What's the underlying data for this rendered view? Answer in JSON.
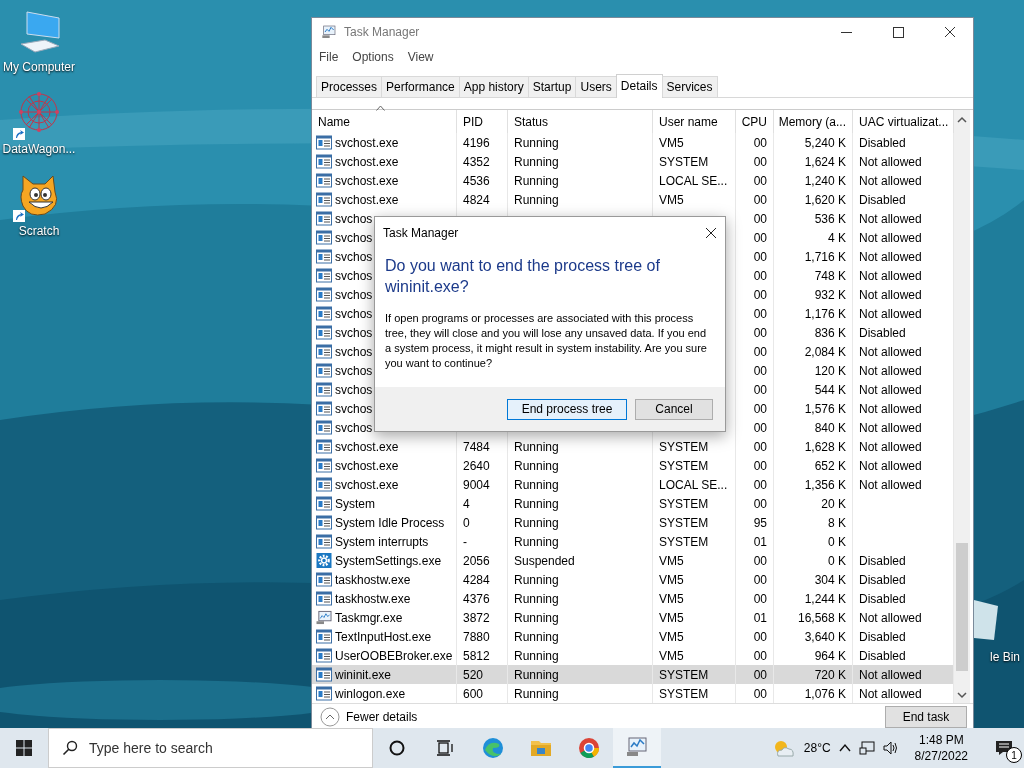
{
  "desktop_icons": [
    {
      "label": "My Computer",
      "kind": "computer",
      "shortcut": false
    },
    {
      "label": "DataWagon...",
      "kind": "network",
      "shortcut": true
    },
    {
      "label": "Scratch",
      "kind": "cat",
      "shortcut": true
    }
  ],
  "recycle_bin": {
    "label": "le Bin"
  },
  "window": {
    "title": "Task Manager",
    "menu": [
      "File",
      "Options",
      "View"
    ],
    "tabs": [
      {
        "label": "Processes",
        "selected": false
      },
      {
        "label": "Performance",
        "selected": false
      },
      {
        "label": "App history",
        "selected": false
      },
      {
        "label": "Startup",
        "selected": false
      },
      {
        "label": "Users",
        "selected": false
      },
      {
        "label": "Details",
        "selected": true
      },
      {
        "label": "Services",
        "selected": false
      }
    ],
    "table": {
      "columns": [
        {
          "label": "Name",
          "sorted": true
        },
        {
          "label": "PID",
          "sorted": false
        },
        {
          "label": "Status",
          "sorted": false
        },
        {
          "label": "User name",
          "sorted": false
        },
        {
          "label": "CPU",
          "sorted": false
        },
        {
          "label": "Memory (a...",
          "sorted": false
        },
        {
          "label": "UAC virtualizat...",
          "sorted": false
        }
      ],
      "rows": [
        {
          "kind": "app",
          "cells": [
            "svchost.exe",
            "4196",
            "Running",
            "VM5",
            "00",
            "5,240 K",
            "Disabled"
          ],
          "selected": false
        },
        {
          "kind": "app",
          "cells": [
            "svchost.exe",
            "4352",
            "Running",
            "SYSTEM",
            "00",
            "1,624 K",
            "Not allowed"
          ],
          "selected": false
        },
        {
          "kind": "app",
          "cells": [
            "svchost.exe",
            "4536",
            "Running",
            "LOCAL SE...",
            "00",
            "1,240 K",
            "Not allowed"
          ],
          "selected": false
        },
        {
          "kind": "app",
          "cells": [
            "svchost.exe",
            "4824",
            "Running",
            "VM5",
            "00",
            "1,620 K",
            "Disabled"
          ],
          "selected": false
        },
        {
          "kind": "app",
          "cells": [
            "svchos",
            null,
            null,
            null,
            "00",
            "536 K",
            "Not allowed"
          ],
          "selected": false
        },
        {
          "kind": "app",
          "cells": [
            "svchos",
            null,
            null,
            null,
            "00",
            "4 K",
            "Not allowed"
          ],
          "selected": false
        },
        {
          "kind": "app",
          "cells": [
            "svchos",
            null,
            null,
            null,
            "00",
            "1,716 K",
            "Not allowed"
          ],
          "selected": false
        },
        {
          "kind": "app",
          "cells": [
            "svchos",
            null,
            null,
            null,
            "00",
            "748 K",
            "Not allowed"
          ],
          "selected": false
        },
        {
          "kind": "app",
          "cells": [
            "svchos",
            null,
            null,
            null,
            "00",
            "932 K",
            "Not allowed"
          ],
          "selected": false
        },
        {
          "kind": "app",
          "cells": [
            "svchos",
            null,
            null,
            null,
            "00",
            "1,176 K",
            "Not allowed"
          ],
          "selected": false
        },
        {
          "kind": "app",
          "cells": [
            "svchos",
            null,
            null,
            null,
            "00",
            "836 K",
            "Disabled"
          ],
          "selected": false
        },
        {
          "kind": "app",
          "cells": [
            "svchos",
            null,
            null,
            null,
            "00",
            "2,084 K",
            "Not allowed"
          ],
          "selected": false
        },
        {
          "kind": "app",
          "cells": [
            "svchos",
            null,
            null,
            null,
            "00",
            "120 K",
            "Not allowed"
          ],
          "selected": false
        },
        {
          "kind": "app",
          "cells": [
            "svchos",
            null,
            null,
            null,
            "00",
            "544 K",
            "Not allowed"
          ],
          "selected": false
        },
        {
          "kind": "app",
          "cells": [
            "svchos",
            null,
            null,
            null,
            "00",
            "1,576 K",
            "Not allowed"
          ],
          "selected": false
        },
        {
          "kind": "app",
          "cells": [
            "svchos",
            null,
            null,
            null,
            "00",
            "840 K",
            "Not allowed"
          ],
          "selected": false
        },
        {
          "kind": "app",
          "cells": [
            "svchost.exe",
            "7484",
            "Running",
            "SYSTEM",
            "00",
            "1,628 K",
            "Not allowed"
          ],
          "selected": false
        },
        {
          "kind": "app",
          "cells": [
            "svchost.exe",
            "2640",
            "Running",
            "SYSTEM",
            "00",
            "652 K",
            "Not allowed"
          ],
          "selected": false
        },
        {
          "kind": "app",
          "cells": [
            "svchost.exe",
            "9004",
            "Running",
            "LOCAL SE...",
            "00",
            "1,356 K",
            "Not allowed"
          ],
          "selected": false
        },
        {
          "kind": "app",
          "cells": [
            "System",
            "4",
            "Running",
            "SYSTEM",
            "00",
            "20 K",
            null
          ],
          "selected": false
        },
        {
          "kind": "app",
          "cells": [
            "System Idle Process",
            "0",
            "Running",
            "SYSTEM",
            "95",
            "8 K",
            null
          ],
          "selected": false
        },
        {
          "kind": "app",
          "cells": [
            "System interrupts",
            "-",
            "Running",
            "SYSTEM",
            "01",
            "0 K",
            null
          ],
          "selected": false
        },
        {
          "kind": "gear",
          "cells": [
            "SystemSettings.exe",
            "2056",
            "Suspended",
            "VM5",
            "00",
            "0 K",
            "Disabled"
          ],
          "selected": false
        },
        {
          "kind": "app",
          "cells": [
            "taskhostw.exe",
            "4284",
            "Running",
            "VM5",
            "00",
            "304 K",
            "Disabled"
          ],
          "selected": false
        },
        {
          "kind": "app",
          "cells": [
            "taskhostw.exe",
            "4376",
            "Running",
            "VM5",
            "00",
            "1,244 K",
            "Disabled"
          ],
          "selected": false
        },
        {
          "kind": "monitor",
          "cells": [
            "Taskmgr.exe",
            "3872",
            "Running",
            "VM5",
            "01",
            "16,568 K",
            "Not allowed"
          ],
          "selected": false
        },
        {
          "kind": "app",
          "cells": [
            "TextInputHost.exe",
            "7880",
            "Running",
            "VM5",
            "00",
            "3,640 K",
            "Disabled"
          ],
          "selected": false
        },
        {
          "kind": "app",
          "cells": [
            "UserOOBEBroker.exe",
            "5812",
            "Running",
            "VM5",
            "00",
            "964 K",
            "Disabled"
          ],
          "selected": false
        },
        {
          "kind": "app",
          "cells": [
            "wininit.exe",
            "520",
            "Running",
            "SYSTEM",
            "00",
            "720 K",
            "Not allowed"
          ],
          "selected": true
        },
        {
          "kind": "app",
          "cells": [
            "winlogon.exe",
            "600",
            "Running",
            "SYSTEM",
            "00",
            "1,076 K",
            "Not allowed"
          ],
          "selected": false
        }
      ]
    },
    "fewer_details": "Fewer details",
    "end_task": "End task"
  },
  "dialog": {
    "title": "Task Manager",
    "heading": "Do you want to end the process tree of wininit.exe?",
    "message": "If open programs or processes are associated with this process tree, they will close and you will lose any unsaved data. If you end a system process, it might result in system instability. Are you sure you want to continue?",
    "buttons": [
      {
        "label": "End process tree",
        "default": true
      },
      {
        "label": "Cancel",
        "default": false
      }
    ]
  },
  "taskbar": {
    "search_placeholder": "Type here to search",
    "apps": [
      {
        "kind": "edge",
        "active": false
      },
      {
        "kind": "folder",
        "active": false
      },
      {
        "kind": "chrome",
        "active": false
      },
      {
        "kind": "monitor",
        "active": true
      }
    ],
    "temperature": "28°C",
    "time": "1:48 PM",
    "date": "8/27/2022",
    "notification_count": "1"
  }
}
